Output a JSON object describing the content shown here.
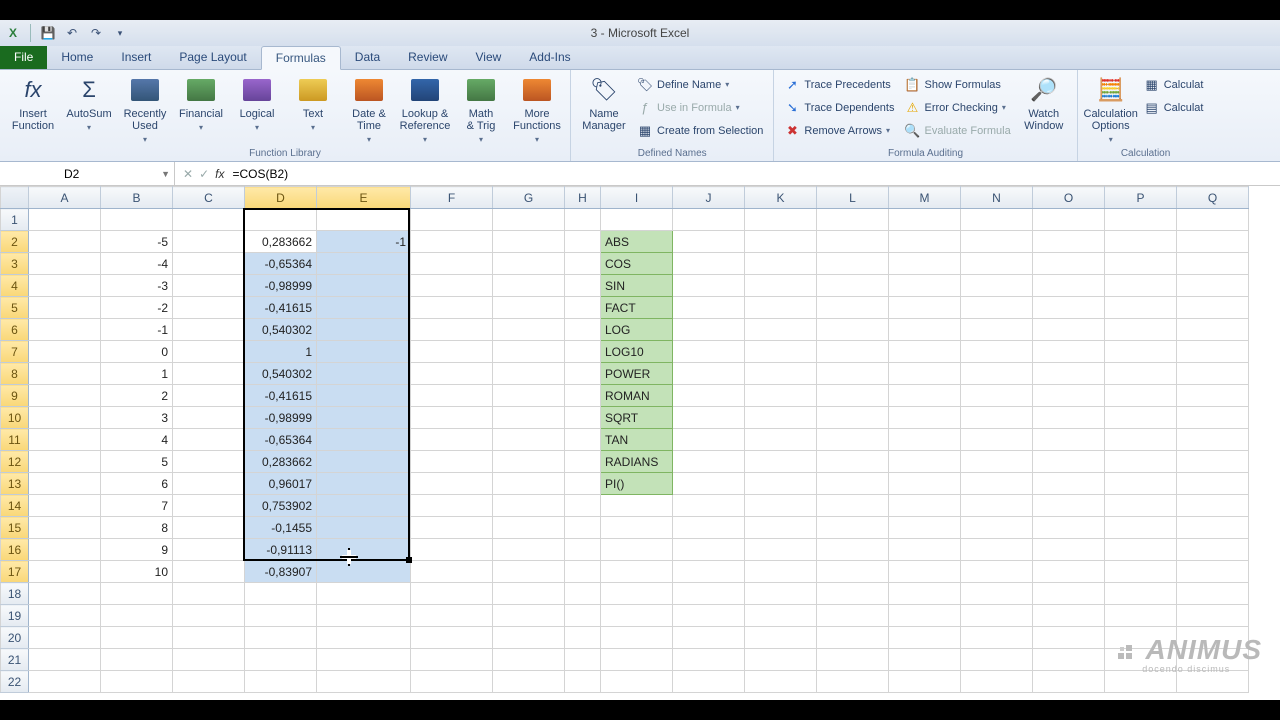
{
  "title": "3 - Microsoft Excel",
  "tabs": {
    "file": "File",
    "home": "Home",
    "insert": "Insert",
    "pagelayout": "Page Layout",
    "formulas": "Formulas",
    "data": "Data",
    "review": "Review",
    "view": "View",
    "addins": "Add-Ins"
  },
  "ribbon": {
    "fl": {
      "insertfn": "Insert\nFunction",
      "autosum": "AutoSum",
      "recent": "Recently\nUsed",
      "financial": "Financial",
      "logical": "Logical",
      "text": "Text",
      "datetime": "Date &\nTime",
      "lookup": "Lookup &\nReference",
      "math": "Math\n& Trig",
      "more": "More\nFunctions",
      "label": "Function Library"
    },
    "dn": {
      "manager": "Name\nManager",
      "define": "Define Name",
      "usein": "Use in Formula",
      "create": "Create from Selection",
      "label": "Defined Names"
    },
    "fa": {
      "precedents": "Trace Precedents",
      "dependents": "Trace Dependents",
      "remove": "Remove Arrows",
      "show": "Show Formulas",
      "error": "Error Checking",
      "eval": "Evaluate Formula",
      "watch": "Watch\nWindow",
      "label": "Formula Auditing"
    },
    "calc": {
      "options": "Calculation\nOptions",
      "now": "Calculat",
      "sheet": "Calculat",
      "label": "Calculation"
    }
  },
  "namebox": "D2",
  "formula": "=COS(B2)",
  "columns": [
    "A",
    "B",
    "C",
    "D",
    "E",
    "F",
    "G",
    "H",
    "I",
    "J",
    "K",
    "L",
    "M",
    "N",
    "O",
    "P",
    "Q"
  ],
  "rows_count": 22,
  "colB": [
    "-5",
    "-4",
    "-3",
    "-2",
    "-1",
    "0",
    "1",
    "2",
    "3",
    "4",
    "5",
    "6",
    "7",
    "8",
    "9",
    "10"
  ],
  "colD": [
    "0,283662",
    "-0,65364",
    "-0,98999",
    "-0,41615",
    "0,540302",
    "1",
    "0,540302",
    "-0,41615",
    "-0,98999",
    "-0,65364",
    "0,283662",
    "0,96017",
    "0,753902",
    "-0,1455",
    "-0,91113",
    "-0,83907"
  ],
  "colE": [
    "-1"
  ],
  "colI_fns": [
    "ABS",
    "COS",
    "SIN",
    "FACT",
    "LOG",
    "LOG10",
    "POWER",
    "ROMAN",
    "SQRT",
    "TAN",
    "RADIANS",
    "PI()"
  ],
  "selection": {
    "from": "D2",
    "to": "E17"
  },
  "watermark": {
    "brand": "ANIMUS",
    "tag": "docendo discimus"
  }
}
